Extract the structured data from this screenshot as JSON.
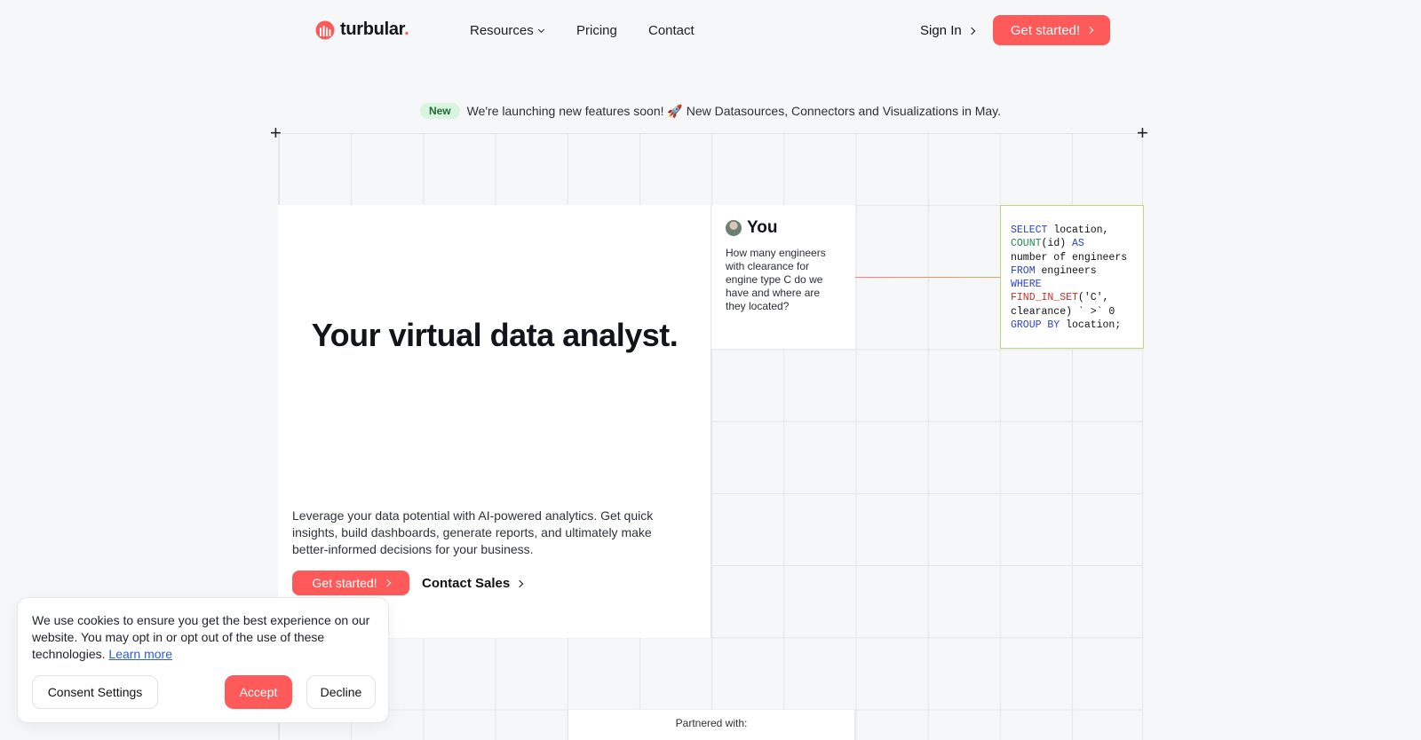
{
  "brand": {
    "name": "turbular",
    "dot": ".",
    "accent_color": "#ff5a5a"
  },
  "nav": {
    "resources_label": "Resources",
    "pricing_label": "Pricing",
    "contact_label": "Contact",
    "signin_label": "Sign In",
    "cta_label": "Get started!"
  },
  "announcement": {
    "badge": "New",
    "text": "We're launching new features soon! 🚀 New Datasources, Connectors and Visualizations in May."
  },
  "hero": {
    "title": "Your virtual data analyst.",
    "description": "Leverage your data potential with AI-powered analytics. Get quick insights, build dashboards, generate reports, and ultimately make better-informed decisions for your business.",
    "cta_label": "Get started!",
    "contact_sales_label": "Contact Sales"
  },
  "chat": {
    "user_label": "You",
    "question": "How many engineers with clearance for engine type C do we have and where are they located?"
  },
  "sql": {
    "lines": [
      [
        {
          "t": "SELECT",
          "c": "kw"
        },
        {
          "t": " location,",
          "c": ""
        }
      ],
      [
        {
          "t": "COUNT",
          "c": "fn"
        },
        {
          "t": "(id) ",
          "c": ""
        },
        {
          "t": "AS",
          "c": "kw"
        }
      ],
      [
        {
          "t": "number of engineers",
          "c": ""
        }
      ],
      [
        {
          "t": "FROM",
          "c": "kw"
        },
        {
          "t": " engineers",
          "c": ""
        }
      ],
      [
        {
          "t": "WHERE",
          "c": "kw"
        }
      ],
      [
        {
          "t": "FIND_IN_SET",
          "c": "fn2"
        },
        {
          "t": "('C',",
          "c": ""
        }
      ],
      [
        {
          "t": "clearance) ` >` 0",
          "c": ""
        }
      ],
      [
        {
          "t": "GROUP BY",
          "c": "kw"
        },
        {
          "t": " location;",
          "c": ""
        }
      ]
    ]
  },
  "partner": {
    "label": "Partnered with:"
  },
  "cookie": {
    "text": "We use cookies to ensure you get the best experience on our website. You may opt in or opt out of the use of these technologies.",
    "learn_more": "Learn more",
    "settings_label": "Consent Settings",
    "accept_label": "Accept",
    "decline_label": "Decline"
  }
}
